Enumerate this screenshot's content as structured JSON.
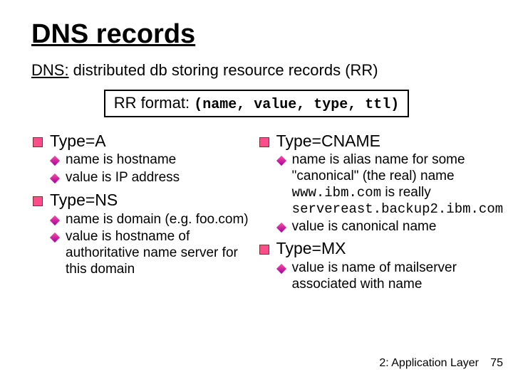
{
  "title": "DNS records",
  "subtitle": {
    "prefix": "DNS:",
    "rest": " distributed db storing resource records (RR)"
  },
  "rrformat": {
    "label": "RR format: ",
    "tuple": "(name, value, type, ttl)"
  },
  "left": {
    "typeA": {
      "heading": "Type=A",
      "sub1": "name is hostname",
      "sub2": "value is IP address"
    },
    "typeNS": {
      "heading": "Type=NS",
      "sub1": "name is domain (e.g. foo.com)",
      "sub2": "value is hostname of authoritative name server for this domain"
    }
  },
  "right": {
    "typeCNAME": {
      "heading": "Type=CNAME",
      "sub1a": "name is alias name for some \"canonical\" (the real) name",
      "sub1b_code1": "www.ibm.com",
      "sub1b_mid": " is really ",
      "sub1b_code2": "servereast.backup2.ibm.com",
      "sub2": "value is canonical name"
    },
    "typeMX": {
      "heading": "Type=MX",
      "sub1": "value is name of mailserver associated with name"
    }
  },
  "footer": "2: Application Layer",
  "pagenum": "75"
}
